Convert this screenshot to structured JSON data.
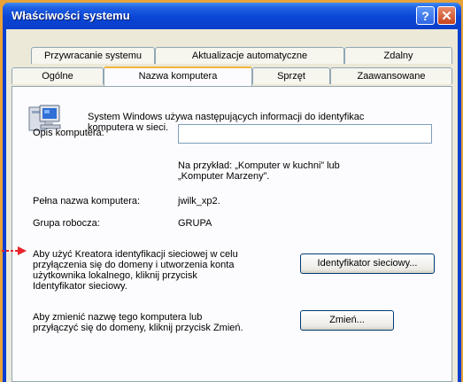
{
  "window": {
    "title": "Właściwości systemu",
    "help_label": "?",
    "close_label": "✕"
  },
  "tabs_row1": [
    "Przywracanie systemu",
    "Aktualizacje automatyczne",
    "Zdalny"
  ],
  "tabs_row2": [
    "Ogólne",
    "Nazwa komputera",
    "Sprzęt",
    "Zaawansowane"
  ],
  "active_tab": "Nazwa komputera",
  "panel": {
    "intro_line1": "System Windows używa następujących informacji do identyfikac",
    "intro_line2": "komputera w sieci.",
    "description_label": "Opis komputera:",
    "description_value": "",
    "example_line1": "Na przykład: „Komputer w kuchni” lub",
    "example_line2": "„Komputer Marzeny”.",
    "full_name_label": "Pełna nazwa komputera:",
    "full_name_value": "jwilk_xp2.",
    "workgroup_label": "Grupa robocza:",
    "workgroup_value": "GRUPA",
    "wizard_text": [
      "Aby użyć Kreatora identyfikacji sieciowej w celu",
      "przyłączenia się do domeny i utworzenia konta",
      "użytkownika lokalnego, kliknij przycisk",
      "Identyfikator sieciowy."
    ],
    "network_id_button": "Identyfikator sieciowy...",
    "rename_text": [
      "Aby zmienić nazwę tego komputera lub",
      "przyłączyć się do domeny, kliknij przycisk Zmień."
    ],
    "change_button": "Zmień..."
  },
  "colors": {
    "titlebar": "#0a45d6",
    "dialog_bg": "#ece9d8",
    "active_tab_accent": "#f4b43a",
    "pointer_arrow": "#e8232a"
  },
  "icons": [
    "computer-icon",
    "help-icon",
    "close-icon",
    "pointer-arrow-icon"
  ]
}
